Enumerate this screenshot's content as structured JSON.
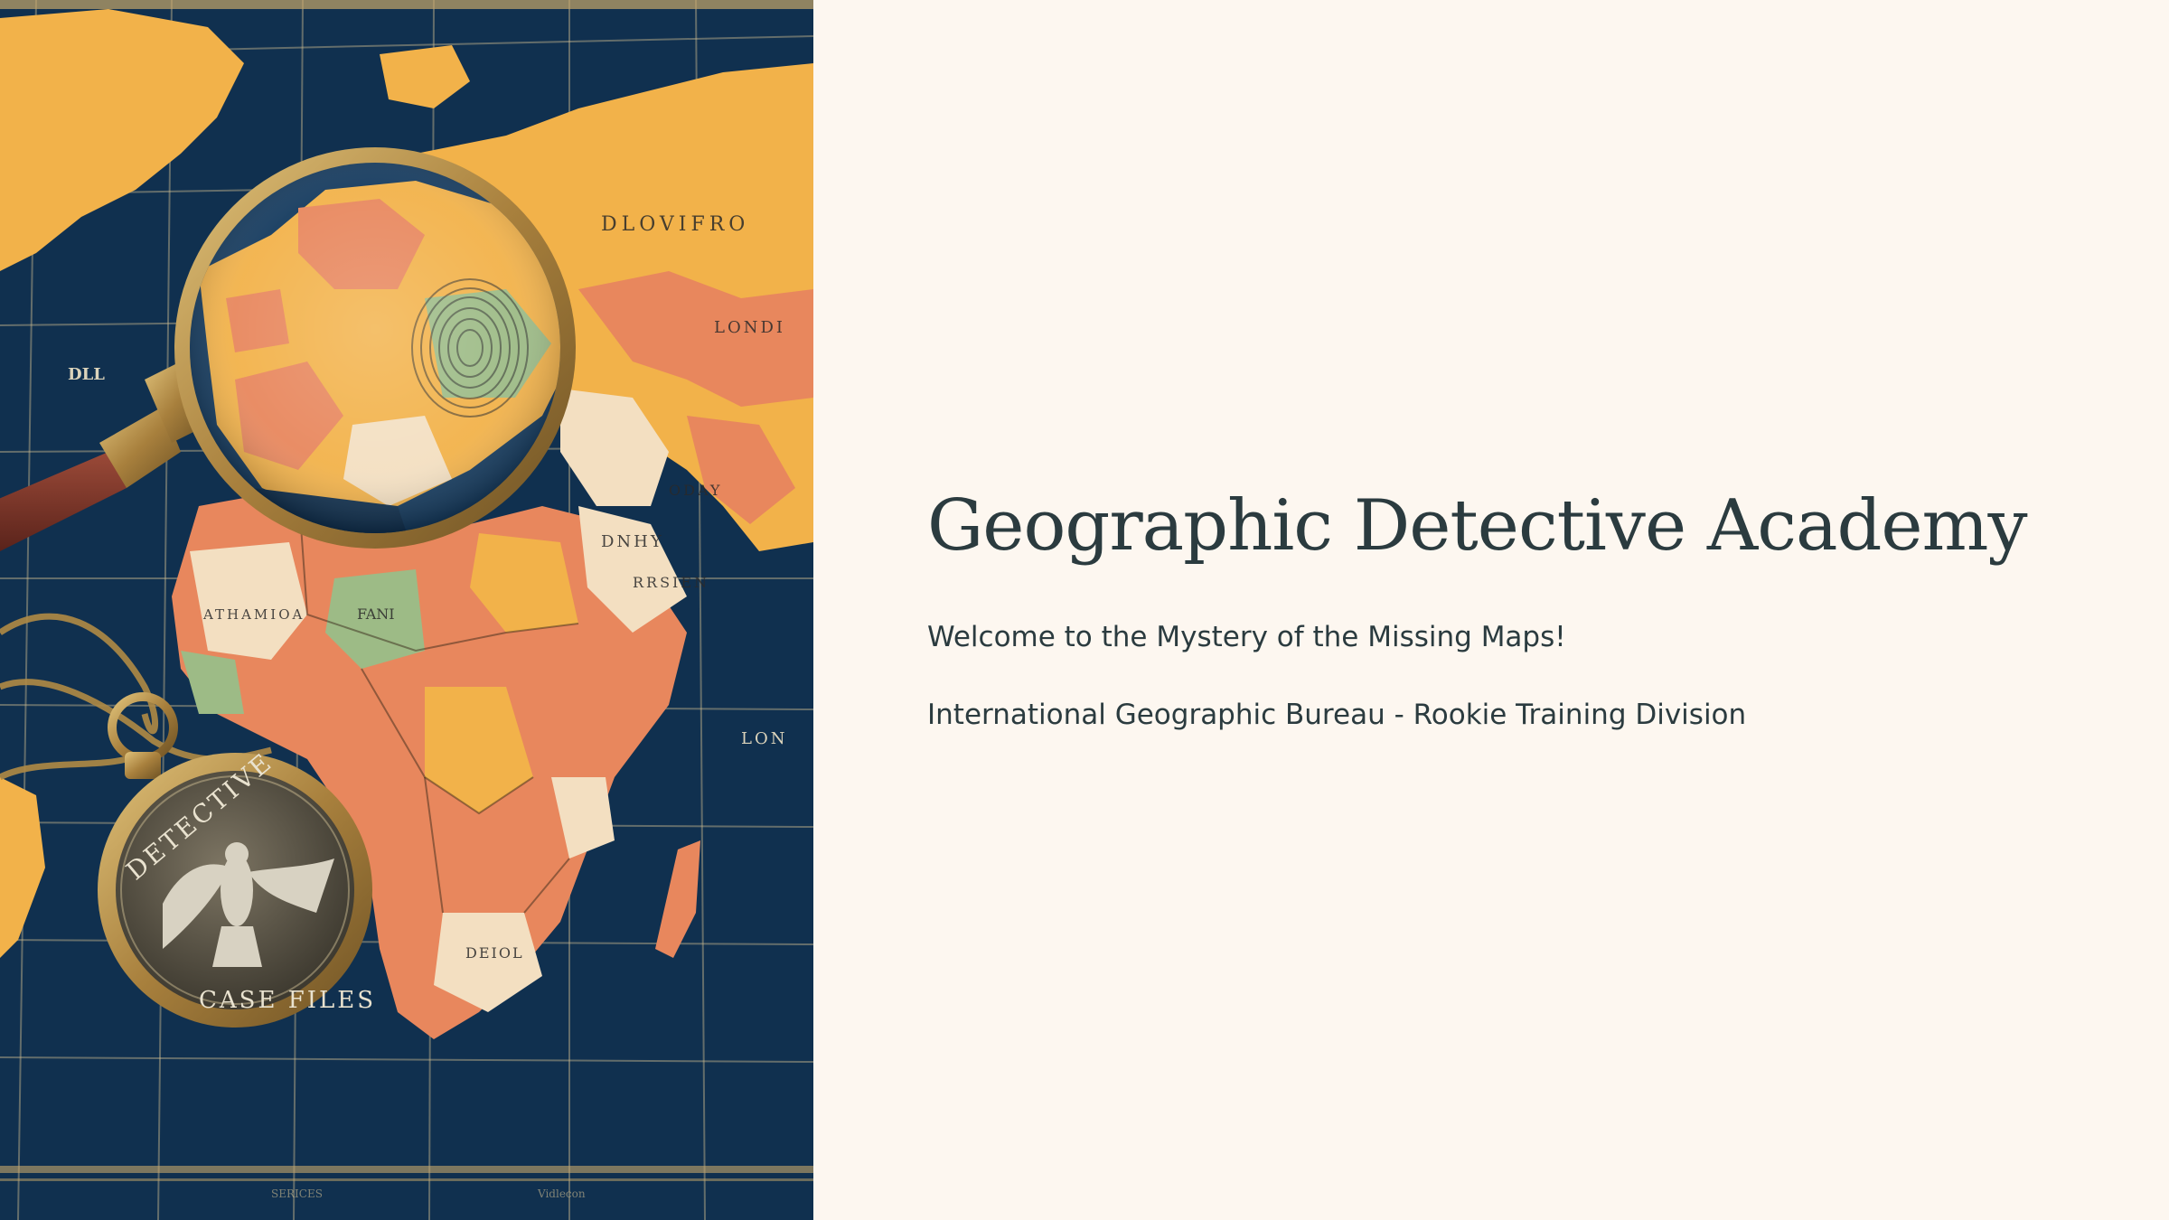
{
  "slide": {
    "title": "Geographic Detective Academy",
    "subtitle": "Welcome to the Mystery of the Missing Maps!",
    "organization": "International Geographic Bureau - Rookie Training Division"
  },
  "image": {
    "description_icon": "detective-map-illustration",
    "badge_text_top": "DETECTIVE",
    "badge_text_bottom": "CASE FILES"
  },
  "colors": {
    "background": "#fdf7f0",
    "text": "#2b3b3f",
    "ocean": "#0f2d4e",
    "land_orange": "#e8875d",
    "land_yellow": "#f2b24a",
    "land_cream": "#f3dfc1",
    "land_green": "#9dbb86",
    "brass": "#b08a45"
  }
}
